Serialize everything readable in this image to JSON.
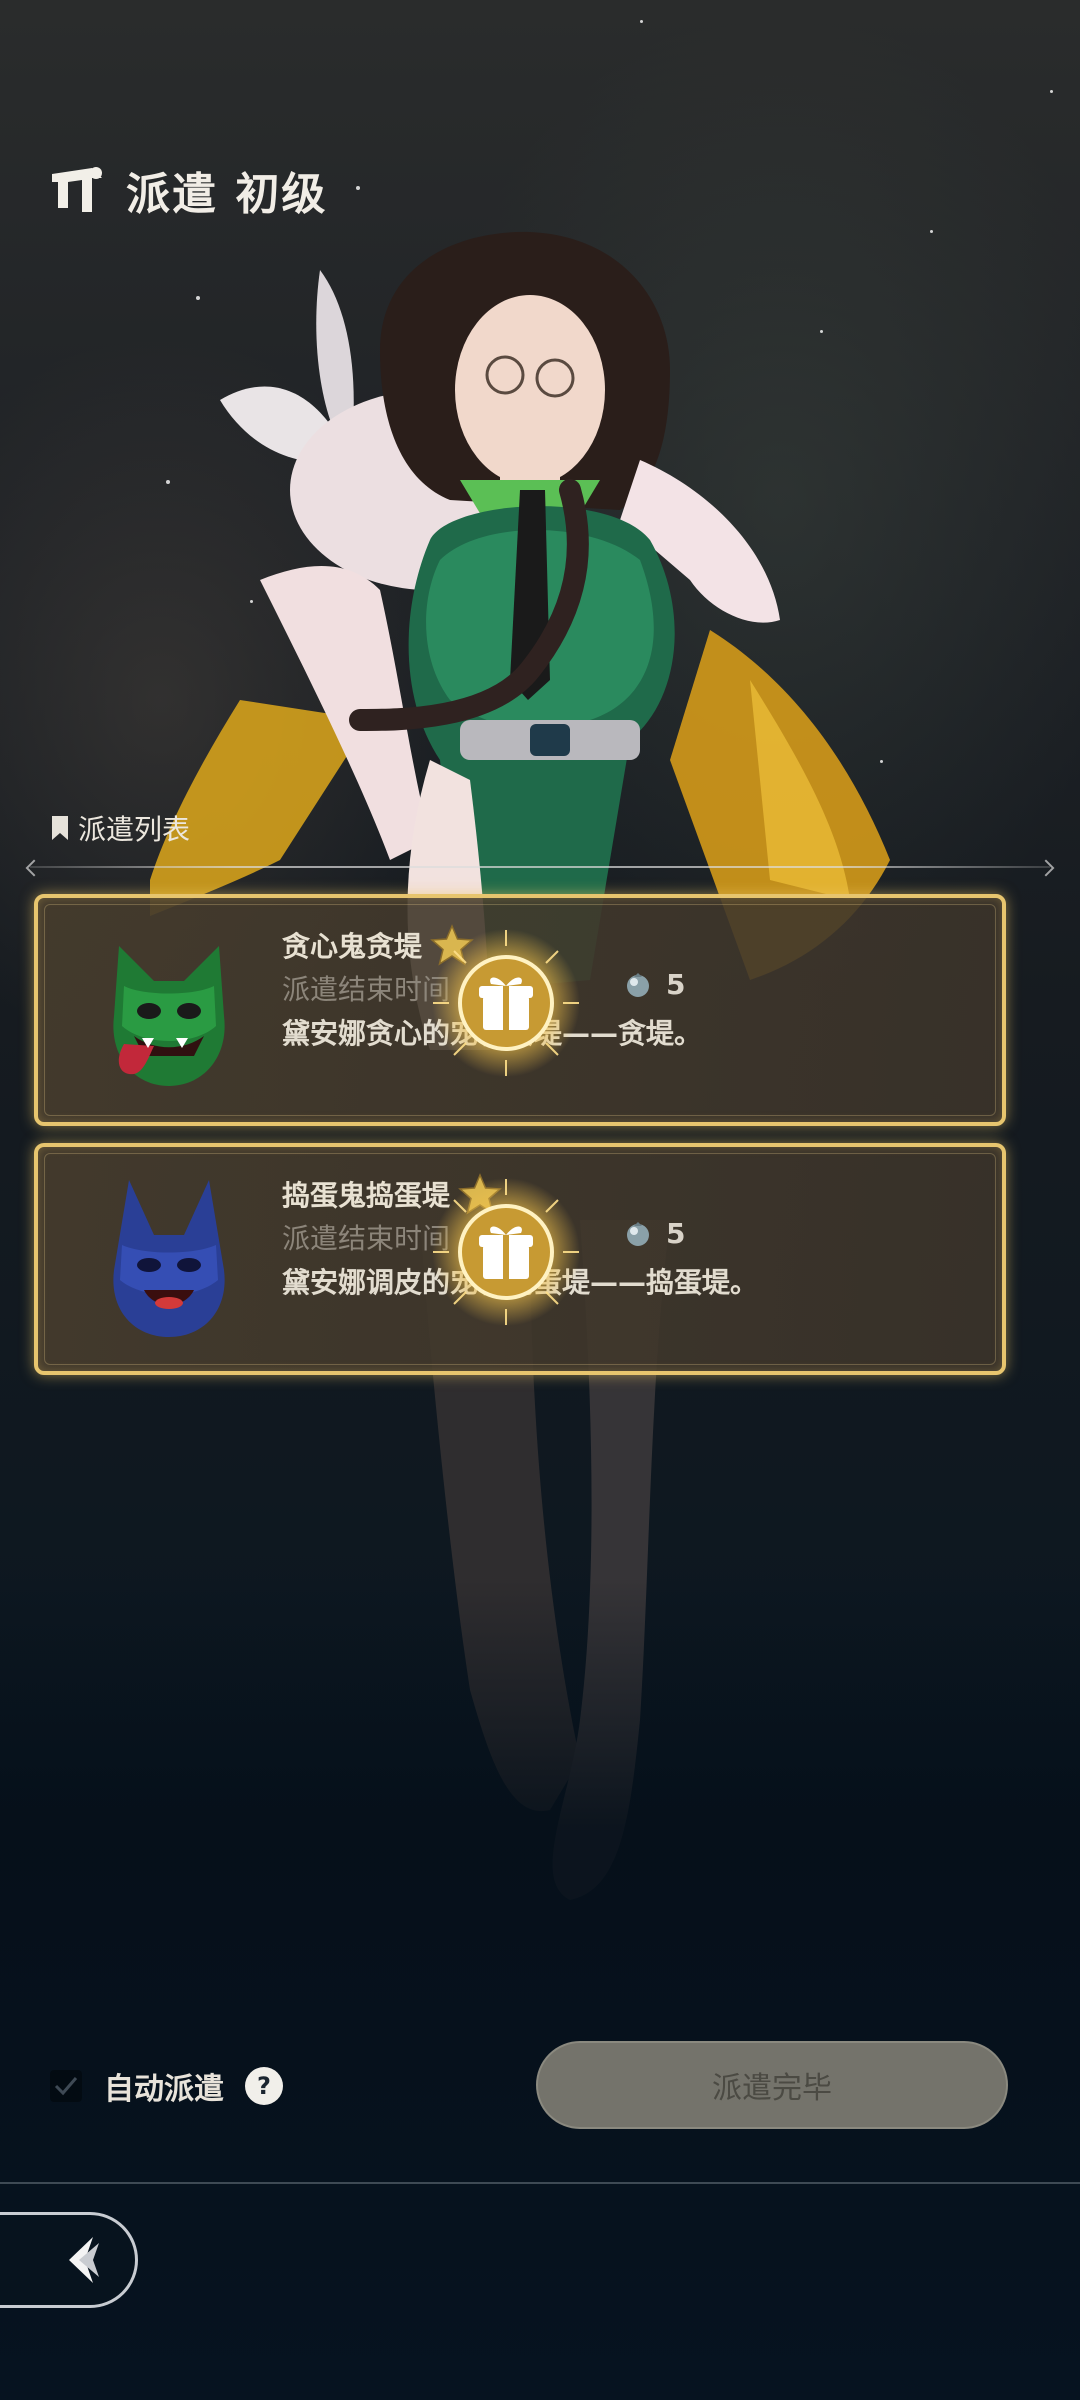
{
  "header": {
    "title": "派遣 初级",
    "icon": "dispatch-banner-icon"
  },
  "list": {
    "label": "派遣列表"
  },
  "missions": [
    {
      "name": "贪心鬼贪堤",
      "time_label": "派遣结束时间",
      "cost": "5",
      "description": "黛安娜贪心的宠物贪堤——贪堤。",
      "monster_color": "#2f9a45",
      "icons": [
        "star-icon",
        "orb-icon",
        "gift-reward-icon"
      ]
    },
    {
      "name": "捣蛋鬼捣蛋堤",
      "time_label": "派遣结束时间",
      "cost": "5",
      "description": "黛安娜调皮的宠物捣蛋堤——捣蛋堤。",
      "monster_color": "#2f4fb0",
      "icons": [
        "star-icon",
        "orb-icon",
        "gift-reward-icon"
      ]
    }
  ],
  "controls": {
    "auto_label": "自动派遣",
    "finish_label": "派遣完毕",
    "back_icon": "back-arrow-icon",
    "help_icon": "help-icon"
  },
  "colors": {
    "card_border": "#e7c56e",
    "button_disabled": "#74736b",
    "background": "#0a1520"
  }
}
